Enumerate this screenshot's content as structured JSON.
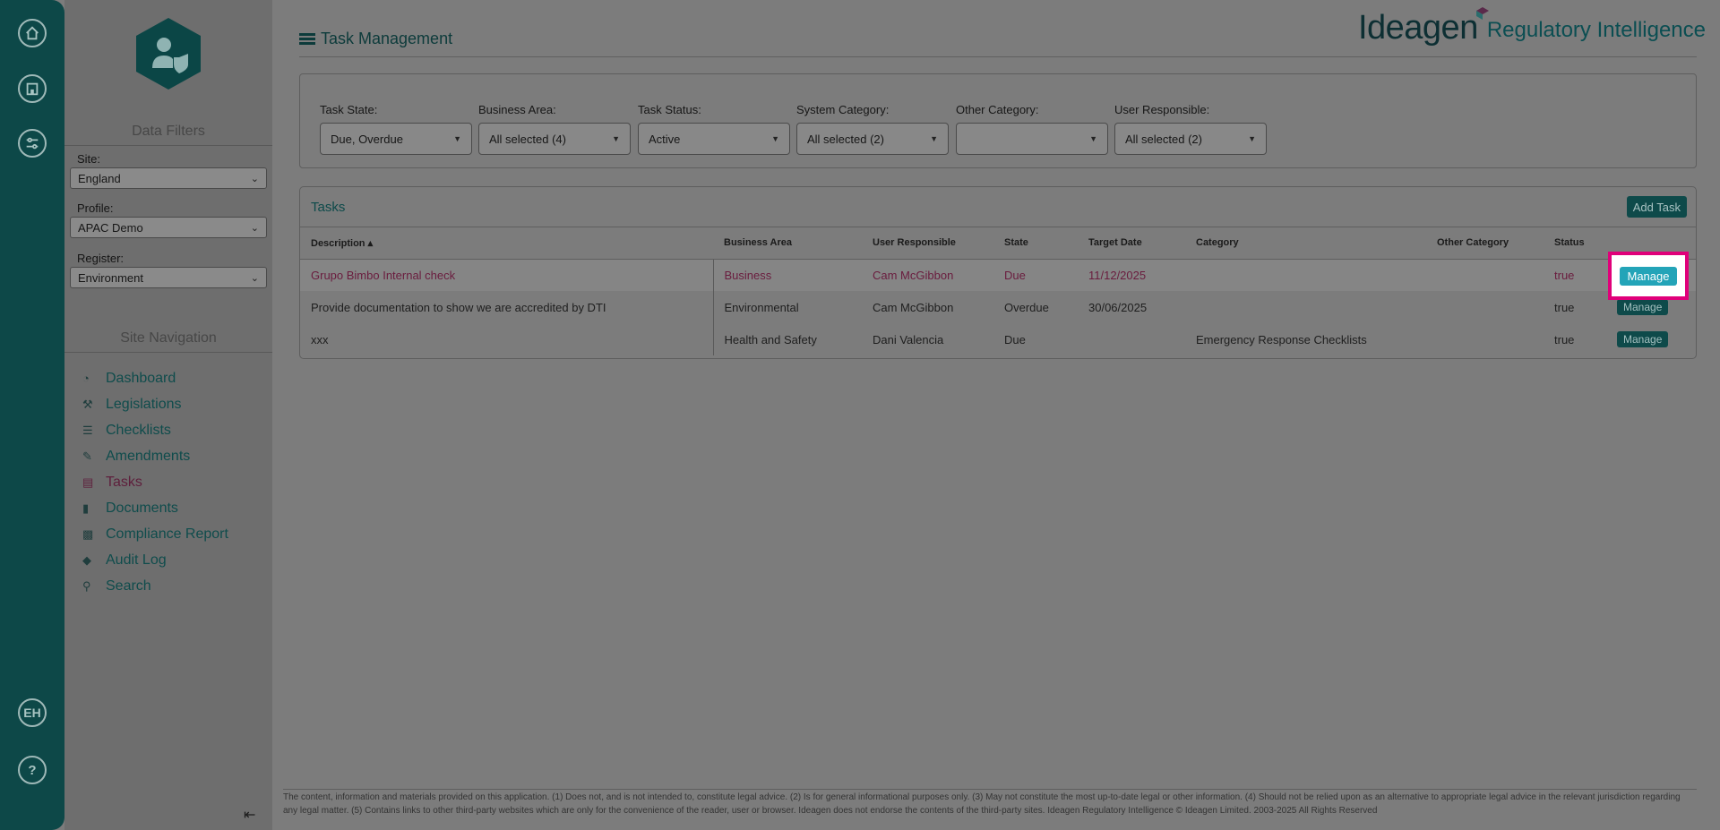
{
  "rail": {
    "user_initials": "EH",
    "help_label": "?"
  },
  "sidebar": {
    "data_filters_title": "Data Filters",
    "site_label": "Site:",
    "site_value": "England",
    "profile_label": "Profile:",
    "profile_value": "APAC Demo",
    "register_label": "Register:",
    "register_value": "Environment",
    "site_nav_title": "Site Navigation",
    "nav": [
      {
        "label": "Dashboard",
        "icon": "dashboard-icon"
      },
      {
        "label": "Legislations",
        "icon": "gavel-icon"
      },
      {
        "label": "Checklists",
        "icon": "list-icon"
      },
      {
        "label": "Amendments",
        "icon": "edit-icon"
      },
      {
        "label": "Tasks",
        "icon": "tasks-icon",
        "active": true
      },
      {
        "label": "Documents",
        "icon": "file-icon"
      },
      {
        "label": "Compliance Report",
        "icon": "bar-chart-icon"
      },
      {
        "label": "Audit Log",
        "icon": "tags-icon"
      },
      {
        "label": "Search",
        "icon": "search-icon"
      }
    ]
  },
  "header": {
    "title": "Task Management",
    "brand_name": "Ideagen",
    "brand_product": "Regulatory Intelligence"
  },
  "filters": [
    {
      "label": "Task State:",
      "value": "Due, Overdue"
    },
    {
      "label": "Business Area:",
      "value": "All selected (4)"
    },
    {
      "label": "Task Status:",
      "value": "Active"
    },
    {
      "label": "System Category:",
      "value": "All selected (2)"
    },
    {
      "label": "Other Category:",
      "value": ""
    },
    {
      "label": "User Responsible:",
      "value": "All selected (2)"
    }
  ],
  "tasks": {
    "title": "Tasks",
    "add_label": "Add Task",
    "columns": {
      "description": "Description ▴",
      "business_area": "Business Area",
      "user": "User Responsible",
      "state": "State",
      "target_date": "Target Date",
      "category": "Category",
      "other_category": "Other Category",
      "status": "Status"
    },
    "rows": [
      {
        "description": "Grupo Bimbo Internal check",
        "business_area": "Business",
        "user": "Cam McGibbon",
        "state": "Due",
        "target_date": "11/12/2025",
        "category": "",
        "other_category": "",
        "status": "true",
        "action": "Manage"
      },
      {
        "description": "Provide documentation to show we are accredited by DTI",
        "business_area": "Environmental",
        "user": "Cam McGibbon",
        "state": "Overdue",
        "target_date": "30/06/2025",
        "category": "",
        "other_category": "",
        "status": "true",
        "action": "Manage"
      },
      {
        "description": "xxx",
        "business_area": "Health and Safety",
        "user": "Dani Valencia",
        "state": "Due",
        "target_date": "",
        "category": "Emergency Response Checklists",
        "other_category": "",
        "status": "true",
        "action": "Manage"
      }
    ]
  },
  "highlight_label": "Manage",
  "footer": "The content, information and materials provided on this application. (1) Does not, and is not intended to, constitute legal advice. (2) Is for general informational purposes only. (3) May not constitute the most up-to-date legal or other information. (4) Should not be relied upon as an alternative to appropriate legal advice in the relevant jurisdiction regarding any legal matter. (5) Contains links to other third-party websites which are only for the convenience of the reader, user or browser. Ideagen does not endorse the contents of the third-party sites. Ideagen Regulatory Intelligence © Ideagen Limited. 2003-2025 All Rights Reserved"
}
